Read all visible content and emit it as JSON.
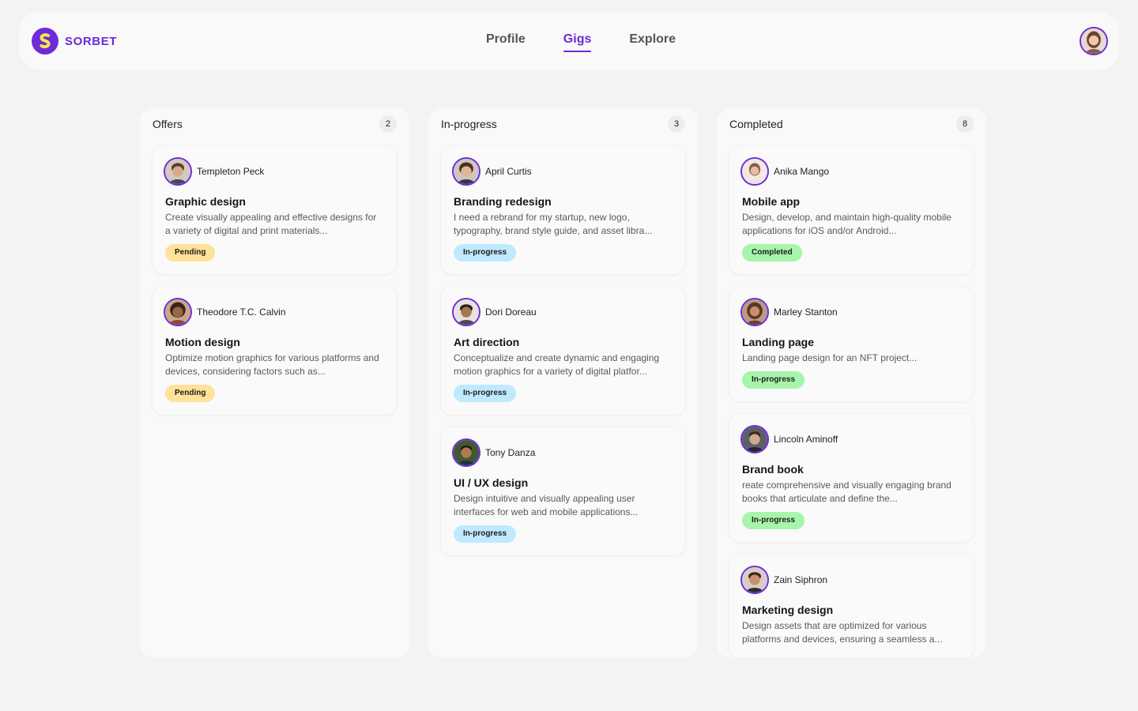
{
  "brand": {
    "name": "SORBET",
    "accent": "#6d2bd9"
  },
  "nav": [
    {
      "label": "Profile",
      "active": false
    },
    {
      "label": "Gigs",
      "active": true
    },
    {
      "label": "Explore",
      "active": false
    }
  ],
  "colors": {
    "pending": "#ffe29a",
    "in_progress_blue": "#bfe9ff",
    "in_progress_green": "#a6f5ab",
    "completed": "#a6f5ab"
  },
  "columns": [
    {
      "title": "Offers",
      "count": "2",
      "cards": [
        {
          "user": "Templeton Peck",
          "title": "Graphic design",
          "desc": "Create visually appealing and effective designs for a variety of digital and print materials...",
          "status": "Pending"
        },
        {
          "user": "Theodore T.C. Calvin",
          "title": "Motion design",
          "desc": "Optimize motion graphics for various platforms and devices, considering factors such as...",
          "status": "Pending"
        }
      ]
    },
    {
      "title": "In-progress",
      "count": "3",
      "cards": [
        {
          "user": "April Curtis",
          "title": "Branding redesign",
          "desc": "I need a rebrand for my startup, new logo, typography, brand style guide, and asset libra...",
          "status": "In-progress"
        },
        {
          "user": "Dori Doreau",
          "title": "Art direction",
          "desc": "Conceptualize and create dynamic and engaging motion graphics for a variety of digital platfor...",
          "status": "In-progress"
        },
        {
          "user": "Tony Danza",
          "title": "UI / UX design",
          "desc": "Design intuitive and visually appealing user interfaces for web and mobile applications...",
          "status": "In-progress"
        }
      ]
    },
    {
      "title": "Completed",
      "count": "8",
      "cards": [
        {
          "user": "Anika Mango",
          "title": "Mobile app",
          "desc": "Design, develop, and maintain high-quality mobile applications for iOS and/or Android...",
          "status": "Completed"
        },
        {
          "user": "Marley Stanton",
          "title": "Landing page",
          "desc": "Landing page design for an NFT project...",
          "status": "In-progress"
        },
        {
          "user": "Lincoln Aminoff",
          "title": "Brand book",
          "desc": "reate comprehensive and visually engaging brand books that articulate and define the...",
          "status": "In-progress"
        },
        {
          "user": "Zain Siphron",
          "title": "Marketing design",
          "desc": "Design assets that are optimized for various platforms and devices, ensuring a seamless a...",
          "status": ""
        }
      ]
    }
  ]
}
